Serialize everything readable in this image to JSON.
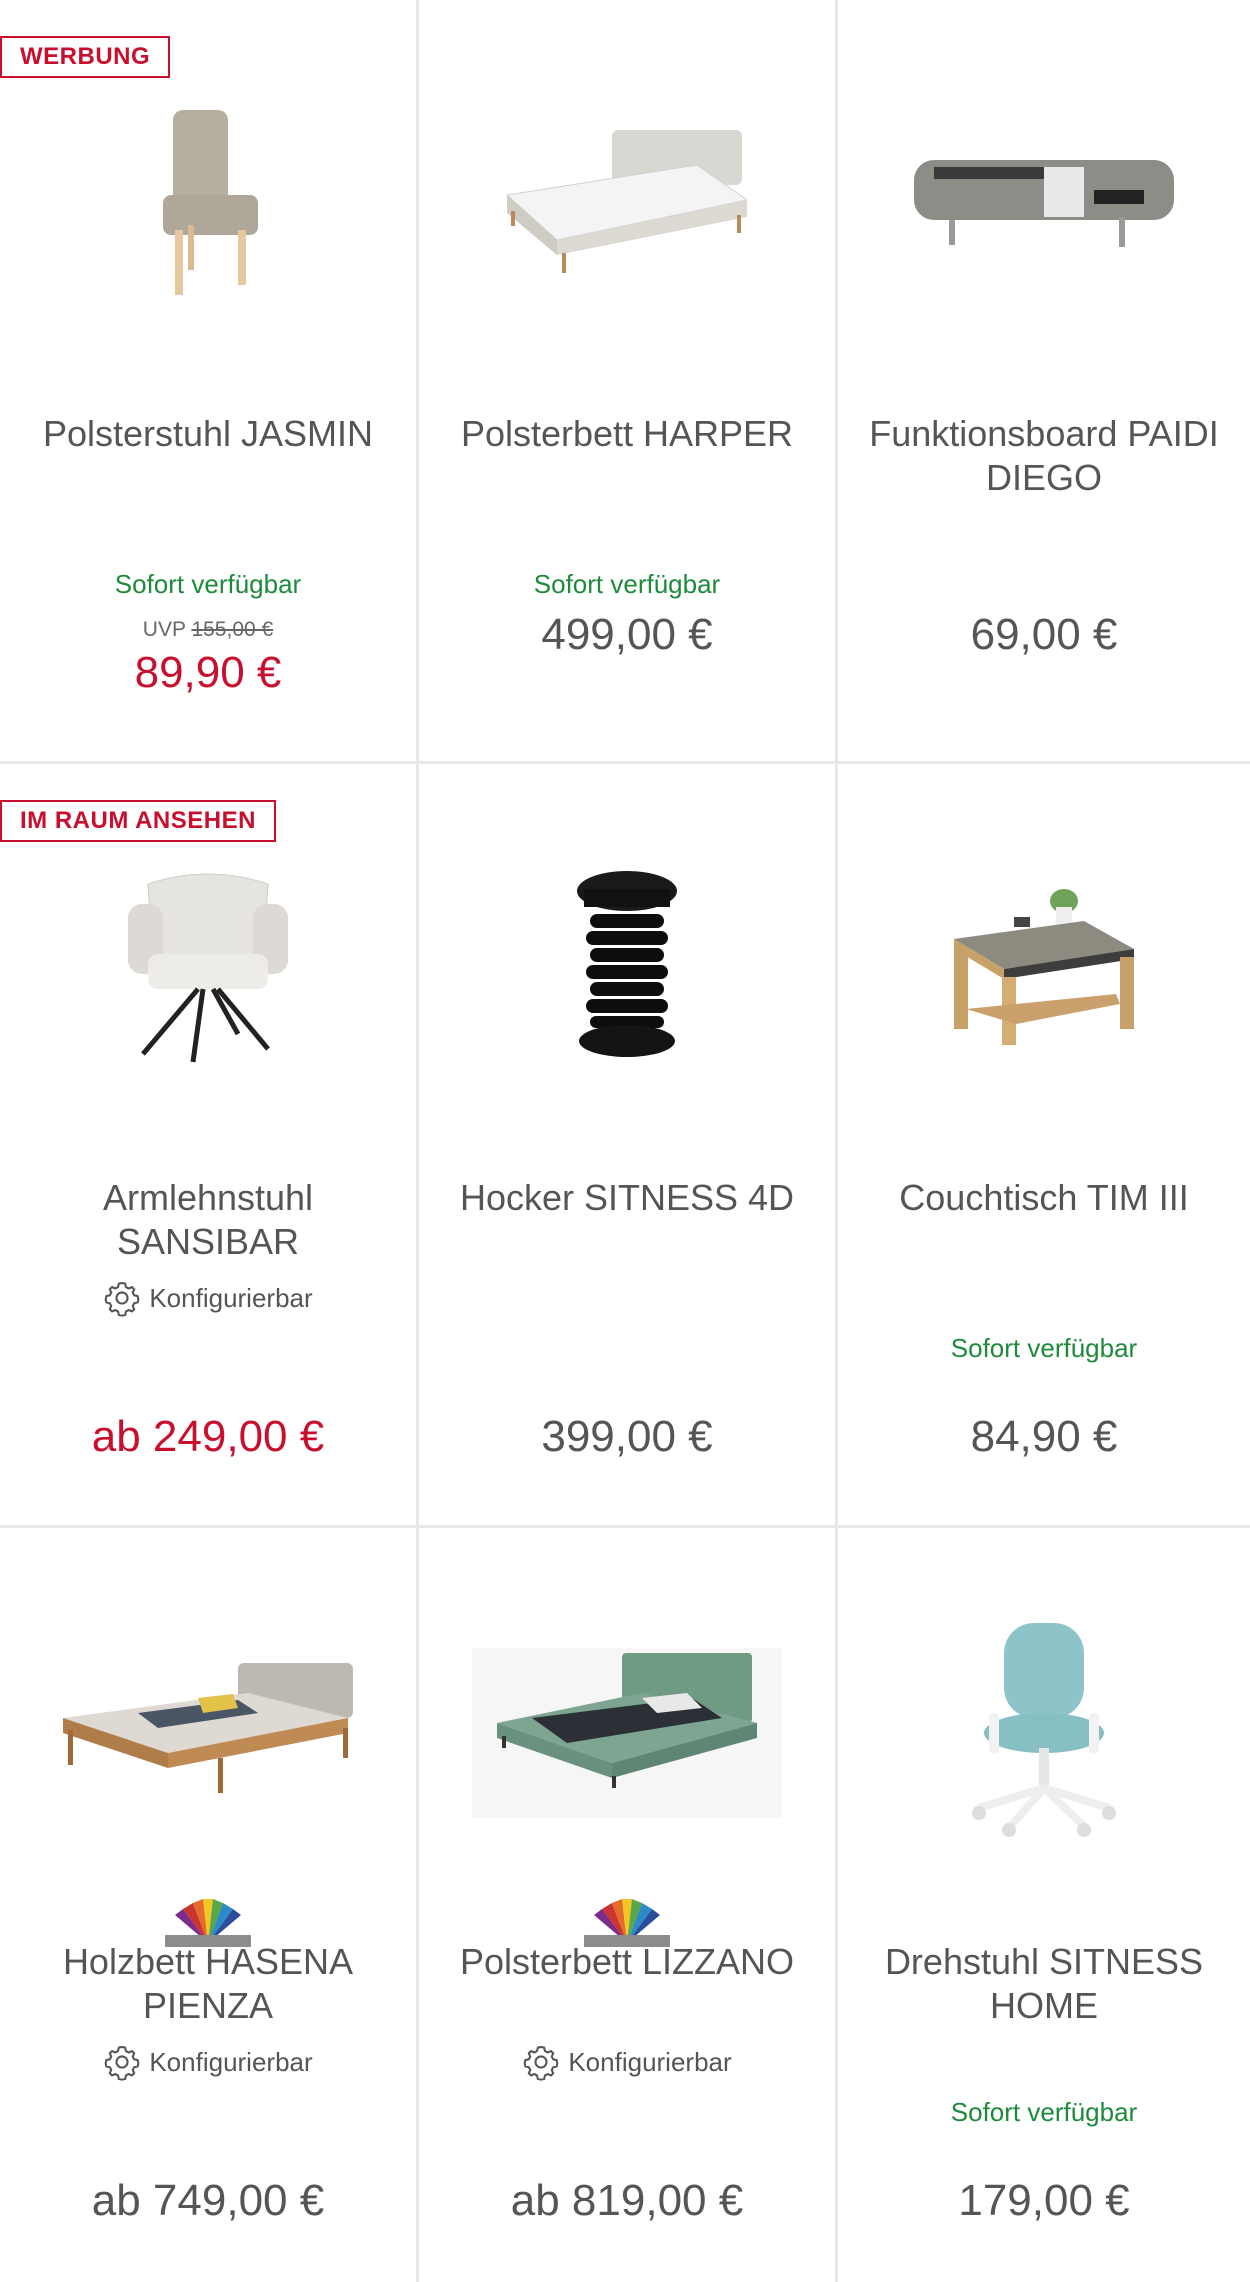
{
  "colors": {
    "accent": "#c8102e",
    "available": "#1e8a3c",
    "text": "#555555",
    "divider": "#e7e7e7"
  },
  "products": [
    {
      "badge": "WERBUNG",
      "image": "chair-beige",
      "title": "Polsterstuhl JASMIN",
      "availability": "Sofort verfügbar",
      "uvp_label": "UVP",
      "uvp_price": "155,00 €",
      "price": "89,90 €",
      "price_red": true
    },
    {
      "image": "bed-grey",
      "title": "Polsterbett HARPER",
      "availability": "Sofort verfügbar",
      "price": "499,00 €"
    },
    {
      "image": "wall-board",
      "title": "Funktionsboard PAIDI DIEGO",
      "price": "69,00 €"
    },
    {
      "badge": "IM RAUM ANSEHEN",
      "image": "armchair-white",
      "title": "Armlehnstuhl SANSIBAR",
      "configurable": "Konfigurierbar",
      "config_icon": "gear-icon",
      "price": "ab 249,00 €",
      "price_red": true
    },
    {
      "image": "stool-black",
      "title": "Hocker SITNESS 4D",
      "price": "399,00 €"
    },
    {
      "image": "coffee-table",
      "title": "Couchtisch TIM III",
      "availability": "Sofort verfügbar",
      "price": "84,90 €"
    },
    {
      "image": "wood-bed",
      "swatch": "color-swatch-icon",
      "title": "Holzbett HASENA PIENZA",
      "configurable": "Konfigurierbar",
      "config_icon": "gear-icon",
      "price": "ab 749,00 €"
    },
    {
      "image": "green-bed",
      "swatch": "color-swatch-icon",
      "title": "Polsterbett LIZZANO",
      "configurable": "Konfigurierbar",
      "config_icon": "gear-icon",
      "price": "ab 819,00 €"
    },
    {
      "image": "office-chair",
      "title": "Drehstuhl SITNESS HOME",
      "availability": "Sofort verfügbar",
      "price": "179,00 €"
    }
  ]
}
